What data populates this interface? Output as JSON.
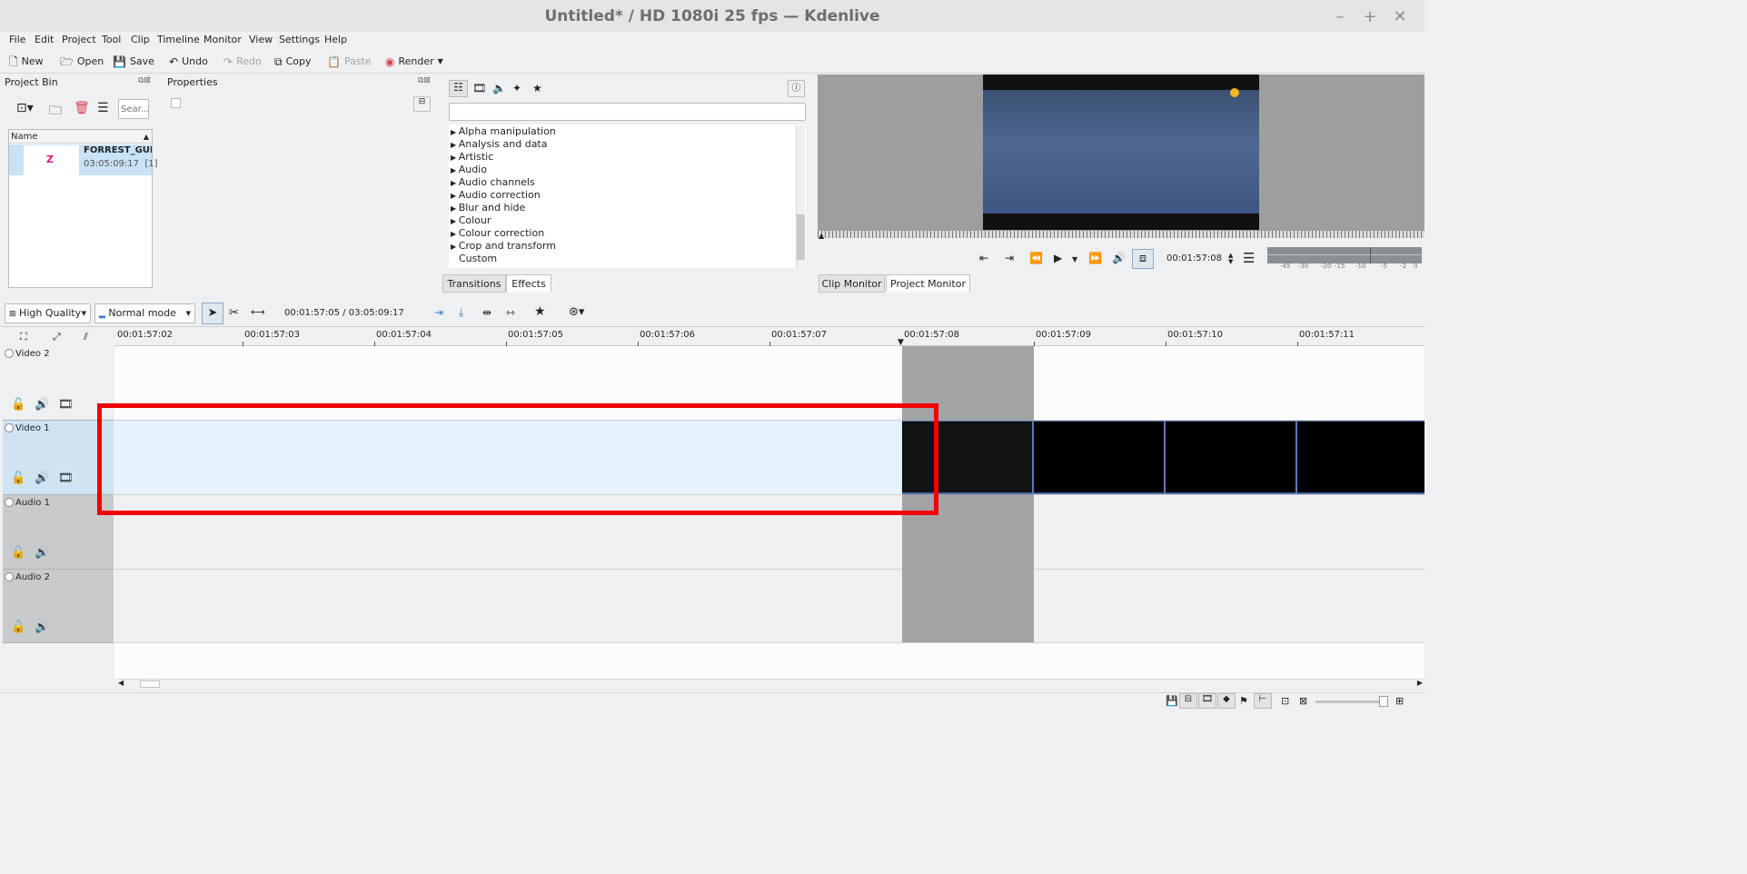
{
  "window": {
    "title": "Untitled* / HD 1080i 25 fps — Kdenlive",
    "minimize": "–",
    "maximize": "+",
    "close": "✕"
  },
  "menu": [
    "File",
    "Edit",
    "Project",
    "Tool",
    "Clip",
    "Timeline",
    "Monitor",
    "View",
    "Settings",
    "Help"
  ],
  "toolbar": {
    "new": "New",
    "open": "Open",
    "save": "Save",
    "undo": "Undo",
    "redo": "Redo",
    "copy": "Copy",
    "paste": "Paste",
    "render": "Render"
  },
  "project_bin": {
    "title": "Project Bin",
    "search_placeholder": "Sear...",
    "column_name": "Name",
    "clip_name": "FORREST_GUMP",
    "clip_duration": "03:05:09:17",
    "clip_count": "[1]"
  },
  "properties": {
    "title": "Properties"
  },
  "effects": {
    "categories": [
      "Alpha manipulation",
      "Analysis and data",
      "Artistic",
      "Audio",
      "Audio channels",
      "Audio correction",
      "Blur and hide",
      "Colour",
      "Colour correction",
      "Crop and transform",
      "Custom"
    ],
    "tabs": [
      "Transitions",
      "Effects"
    ],
    "active_tab": "Effects"
  },
  "monitor": {
    "timecode": "00:01:57:08",
    "tabs": [
      "Clip Monitor",
      "Project Monitor"
    ],
    "active_tab": "Project Monitor",
    "meter_labels": [
      "-45",
      "-30",
      "-20",
      "-15",
      "-10",
      "-5",
      "-2",
      "0"
    ]
  },
  "timeline_toolbar": {
    "quality": "High Quality",
    "mode": "Normal mode",
    "position": "00:01:57:05 / 03:05:09:17"
  },
  "ruler": {
    "labels": [
      "00:01:57:02",
      "00:01:57:03",
      "00:01:57:04",
      "00:01:57:05",
      "00:01:57:06",
      "00:01:57:07",
      "00:01:57:08",
      "00:01:57:09",
      "00:01:57:10",
      "00:01:57:11"
    ]
  },
  "tracks": [
    {
      "name": "Video 2",
      "type": "video"
    },
    {
      "name": "Video 1",
      "type": "video"
    },
    {
      "name": "Audio 1",
      "type": "audio"
    },
    {
      "name": "Audio 2",
      "type": "audio"
    }
  ],
  "colors": {
    "selection": "#c9e2f5",
    "highlight_box": "#f20000",
    "clip_border": "#4b6aa0"
  }
}
